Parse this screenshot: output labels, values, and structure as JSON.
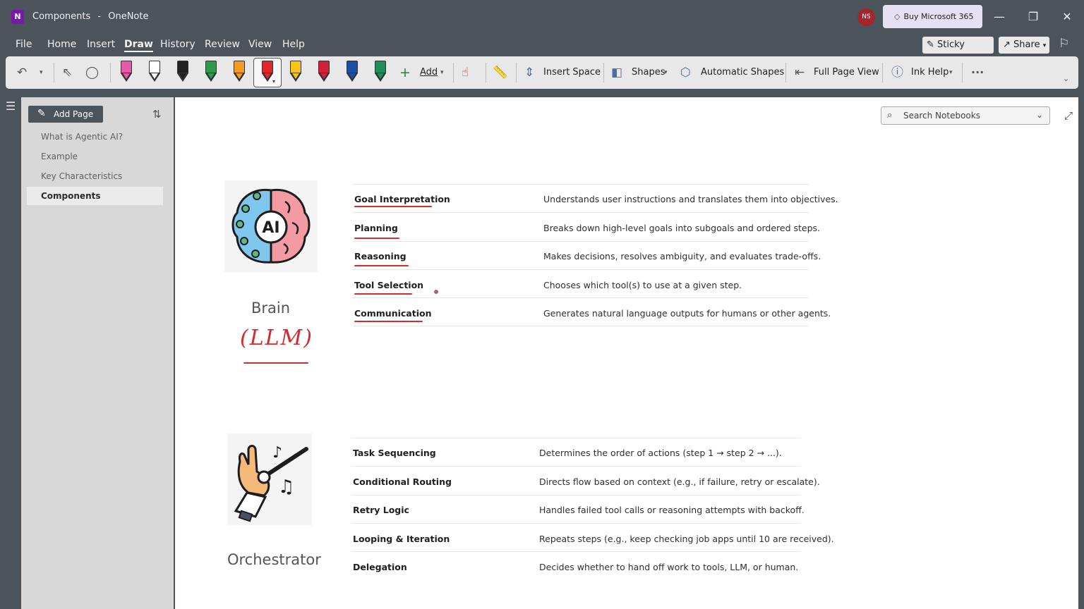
{
  "window": {
    "app_logo": "N",
    "doc_title": "Components",
    "separator": "-",
    "app_name": "OneNote",
    "user_initials": "NS",
    "buy_label": "Buy Microsoft 365"
  },
  "menu": {
    "items": [
      "File",
      "Home",
      "Insert",
      "Draw",
      "History",
      "Review",
      "View",
      "Help"
    ],
    "sticky_notes": "Sticky Notes",
    "share": "Share"
  },
  "ribbon": {
    "add_label": "Add",
    "insert_space": "Insert Space",
    "shapes": "Shapes",
    "automatic_shapes": "Automatic Shapes",
    "full_page_view": "Full Page View",
    "ink_help": "Ink Help",
    "more": "···",
    "pen_colors": [
      "#e75aa5",
      "#ffffff",
      "#222222",
      "#2e9a4e",
      "#f39c1f",
      "#e2262b",
      "#f5c518",
      "#d21f3c",
      "#1a4fa3",
      "#1e8f5a"
    ]
  },
  "sidebar": {
    "add_page": "Add Page",
    "pages": [
      "What is Agentic AI?",
      "Example",
      "Key Characteristics",
      "Components"
    ],
    "active_page": "Components"
  },
  "search": {
    "placeholder": "Search Notebooks"
  },
  "sections": [
    {
      "caption": "Brain",
      "handwritten": "(LLM)",
      "rows": [
        {
          "term": "Goal Interpretation",
          "desc": "Understands user instructions and translates them into objectives."
        },
        {
          "term": "Planning",
          "desc": "Breaks down high-level goals into subgoals and ordered steps."
        },
        {
          "term": "Reasoning",
          "desc": "Makes decisions, resolves ambiguity, and evaluates trade-offs."
        },
        {
          "term": "Tool Selection",
          "desc": "Chooses which tool(s) to use at a given step."
        },
        {
          "term": "Communication",
          "desc": "Generates natural language outputs for humans or other agents."
        }
      ]
    },
    {
      "caption": "Orchestrator",
      "rows": [
        {
          "term": "Task Sequencing",
          "desc": "Determines the order of actions (step 1 → step 2 → ...)."
        },
        {
          "term": "Conditional Routing",
          "desc": "Directs flow based on context (e.g., if failure, retry or escalate)."
        },
        {
          "term": "Retry Logic",
          "desc": "Handles failed tool calls or reasoning attempts with backoff."
        },
        {
          "term": "Looping & Iteration",
          "desc": "Repeats steps (e.g., keep checking job apps until 10 are received)."
        },
        {
          "term": "Delegation",
          "desc": "Decides whether to hand off work to tools, LLM, or human."
        }
      ]
    }
  ],
  "brain_icon_text": "AI",
  "colors": {
    "ink_red": "#d62b30",
    "accent_purple": "#7719aa",
    "chrome": "#4b535b"
  }
}
